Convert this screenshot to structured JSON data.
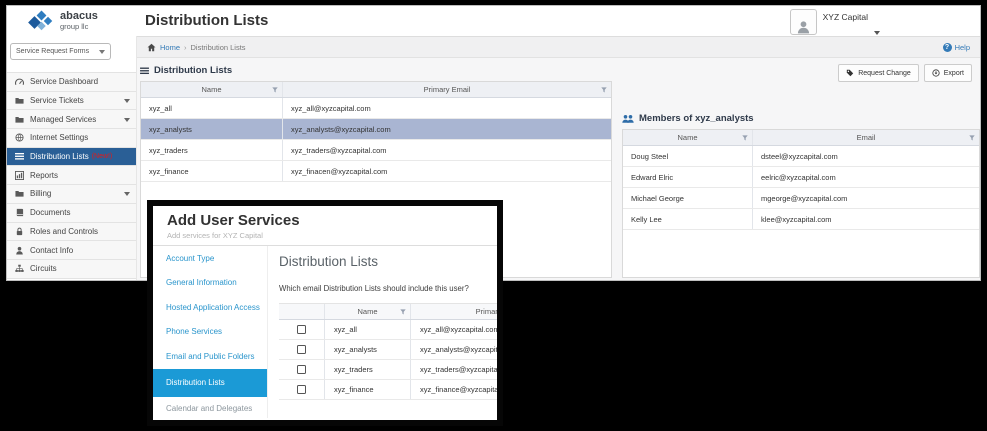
{
  "app": {
    "logo": {
      "brand_top": "abacus",
      "brand_bottom": "group llc"
    },
    "title": "Distribution Lists",
    "account": {
      "name": "XYZ Capital"
    },
    "breadcrumb": {
      "home": "Home",
      "current": "Distribution Lists",
      "help": "Help"
    },
    "sidebar": {
      "forms_dropdown": "Service Request Forms",
      "items": [
        {
          "label": "Service Dashboard",
          "icon": "dashboard-icon"
        },
        {
          "label": "Service Tickets",
          "icon": "folder-icon",
          "caret": true
        },
        {
          "label": "Managed Services",
          "icon": "folder-icon",
          "caret": true
        },
        {
          "label": "Internet Settings",
          "icon": "globe-icon"
        },
        {
          "label": "Distribution Lists",
          "icon": "list-icon",
          "badge": "(New!)",
          "selected": true
        },
        {
          "label": "Reports",
          "icon": "chart-icon"
        },
        {
          "label": "Billing",
          "icon": "folder-icon",
          "caret": true
        },
        {
          "label": "Documents",
          "icon": "book-icon"
        },
        {
          "label": "Roles and Controls",
          "icon": "lock-icon"
        },
        {
          "label": "Contact Info",
          "icon": "user-icon"
        },
        {
          "label": "Circuits",
          "icon": "sitemap-icon"
        }
      ]
    },
    "toolbar": {
      "request_change": "Request Change",
      "export": "Export"
    },
    "lists_panel": {
      "title": "Distribution Lists",
      "columns": [
        "Name",
        "Primary Email"
      ],
      "rows": [
        {
          "name": "xyz_all",
          "email": "xyz_all@xyzcapital.com",
          "selected": false
        },
        {
          "name": "xyz_analysts",
          "email": "xyz_analysts@xyzcapital.com",
          "selected": true
        },
        {
          "name": "xyz_traders",
          "email": "xyz_traders@xyzcapital.com",
          "selected": false
        },
        {
          "name": "xyz_finance",
          "email": "xyz_finacen@xyzcapital.com",
          "selected": false
        }
      ]
    },
    "members_panel": {
      "title": "Members of xyz_analysts",
      "columns": [
        "Name",
        "Email"
      ],
      "rows": [
        {
          "name": "Doug Steel",
          "email": "dsteel@xyzcapital.com"
        },
        {
          "name": "Edward Elric",
          "email": "eelric@xyzcapital.com"
        },
        {
          "name": "Michael George",
          "email": "mgeorge@xyzcapital.com"
        },
        {
          "name": "Kelly Lee",
          "email": "klee@xyzcapital.com"
        }
      ]
    }
  },
  "modal": {
    "title": "Add User Services",
    "subtitle": "Add services for XYZ Capital",
    "nav": [
      {
        "label": "Account Type"
      },
      {
        "label": "General Information"
      },
      {
        "label": "Hosted Application Access"
      },
      {
        "label": "Phone Services"
      },
      {
        "label": "Email and Public Folders"
      },
      {
        "label": "Distribution Lists",
        "selected": true
      },
      {
        "label": "Calendar and Delegates",
        "muted": true
      }
    ],
    "heading": "Distribution Lists",
    "question": "Which email Distribution Lists should include this user?",
    "columns": [
      "Name",
      "Primary Email"
    ],
    "rows": [
      {
        "checked": false,
        "name": "xyz_all",
        "email": "xyz_all@xyzcapital.com"
      },
      {
        "checked": false,
        "name": "xyz_analysts",
        "email": "xyz_analysts@xyzcapital.com"
      },
      {
        "checked": false,
        "name": "xyz_traders",
        "email": "xyz_traders@xyzcapital.com"
      },
      {
        "checked": false,
        "name": "xyz_finance",
        "email": "xyz_finance@xyzcapital.com"
      }
    ]
  },
  "colors": {
    "sidebar_selected": "#2a5f96",
    "modal_selected": "#1b9ad6",
    "accent_blue": "#337ab7",
    "selected_row": "#a9b5d2",
    "new_badge_red": "#e01b1b"
  }
}
